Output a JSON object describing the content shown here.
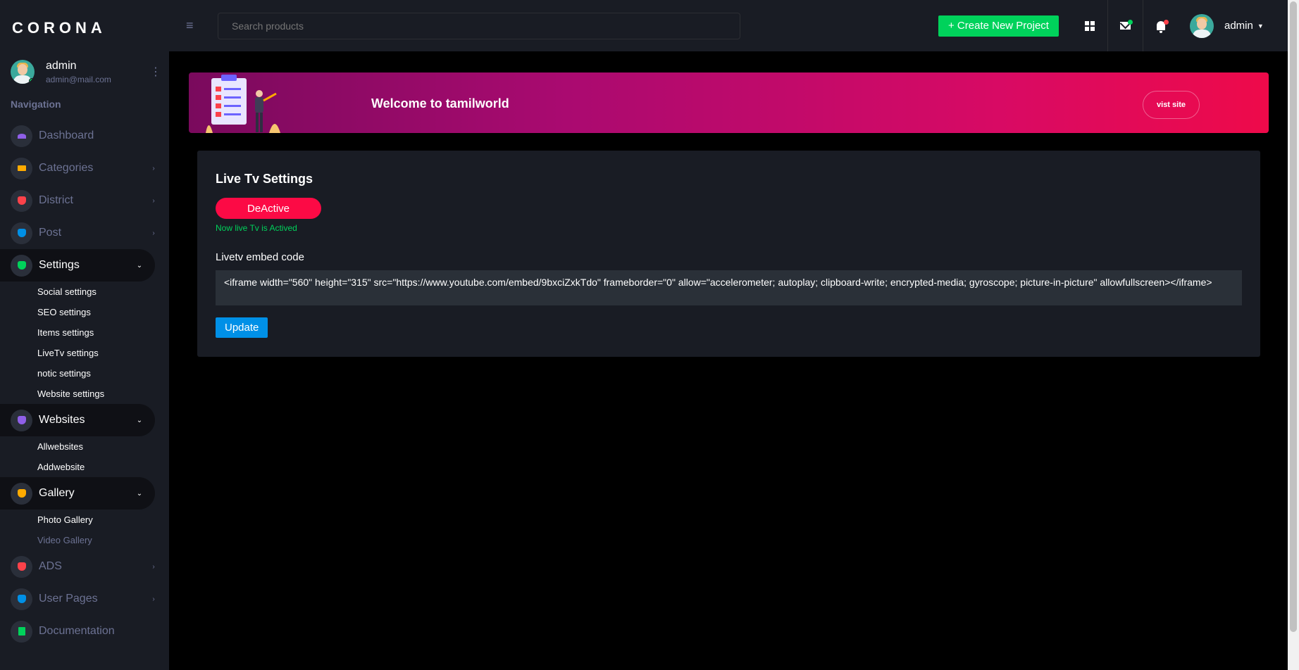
{
  "brand": "CORONA",
  "profile": {
    "name": "admin",
    "email": "admin@mail.com"
  },
  "nav": {
    "caption": "Navigation",
    "dashboard": "Dashboard",
    "categories": "Categories",
    "district": "District",
    "post": "Post",
    "settings": "Settings",
    "settings_sub": [
      "Social settings",
      "SEO settings",
      "Items settings",
      "LiveTv settings",
      "notic settings",
      "Website settings"
    ],
    "websites": "Websites",
    "websites_sub": [
      "Allwebsites",
      "Addwebsite"
    ],
    "gallery": "Gallery",
    "gallery_sub": [
      "Photo Gallery",
      "Video Gallery"
    ],
    "ads": "ADS",
    "user_pages": "User Pages",
    "documentation": "Documentation",
    "icon_colors": {
      "dashboard": "#8f5fe8",
      "categories": "#ffab00",
      "district": "#fc424a",
      "post": "#0090e7",
      "settings": "#00d25b",
      "websites": "#8f5fe8",
      "gallery": "#ffab00",
      "ads": "#fc424a",
      "user_pages": "#0090e7",
      "documentation": "#00d25b"
    }
  },
  "topbar": {
    "search_placeholder": "Search products",
    "create_button": "+ Create New Project",
    "user": "admin",
    "icons": [
      "grid-icon",
      "mail-icon",
      "bell-icon"
    ]
  },
  "banner": {
    "title": "Welcome to tamilworld",
    "button": "vist site"
  },
  "card": {
    "title": "Live Tv Settings",
    "toggle_button": "DeActive",
    "status_text": "Now live Tv is Actived",
    "embed_label": "Livetv embed code",
    "embed_value": "<iframe width=\"560\" height=\"315\" src=\"https://www.youtube.com/embed/9bxciZxkTdo\" frameborder=\"0\" allow=\"accelerometer; autoplay; clipboard-write; encrypted-media; gyroscope; picture-in-picture\" allowfullscreen></iframe>",
    "update_button": "Update"
  },
  "colors": {
    "accent_green": "#00d25b",
    "accent_red": "#fc0a45",
    "accent_blue": "#0090e7",
    "sidebar_bg": "#191c24"
  }
}
